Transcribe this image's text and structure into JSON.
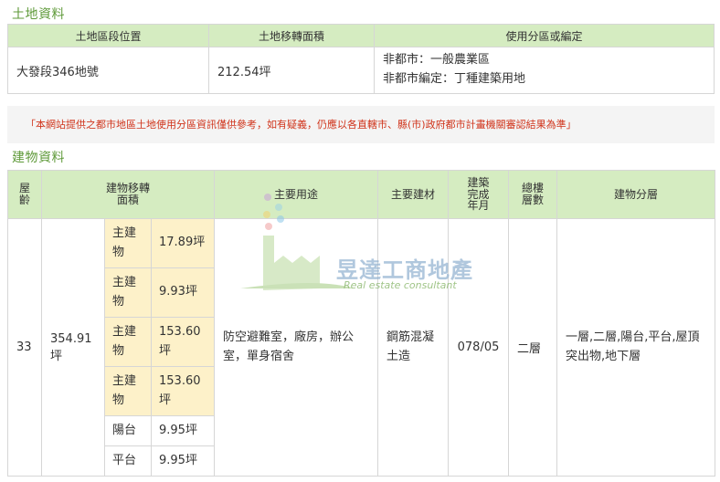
{
  "land_section": {
    "title": "土地資料",
    "headers": [
      "土地區段位置",
      "土地移轉面積",
      "使用分區或編定"
    ],
    "row": {
      "location": "大發段346地號",
      "area": "212.54坪",
      "zoning_line1": "非都市：一般農業區",
      "zoning_line2": "非都市編定：丁種建築用地"
    }
  },
  "notice": "「本網站提供之都市地區土地使用分區資訊僅供參考，如有疑義，仍應以各直轄市、縣(市)政府都市計畫機關審認結果為準」",
  "building_section": {
    "title": "建物資料",
    "headers": {
      "age": "屋齡",
      "area": "建物移轉面積",
      "use": "主要用途",
      "material": "主要建材",
      "completion": "建築完成年月",
      "floors": "總樓層數",
      "levels": "建物分層"
    },
    "row": {
      "age": "33",
      "total_area": "354.91坪",
      "sub_areas": [
        {
          "label": "主建物",
          "area": "17.89坪",
          "highlight": true
        },
        {
          "label": "主建物",
          "area": "9.93坪",
          "highlight": true
        },
        {
          "label": "主建物",
          "area": "153.60坪",
          "highlight": true
        },
        {
          "label": "主建物",
          "area": "153.60坪",
          "highlight": true
        },
        {
          "label": "陽台",
          "area": "9.95坪",
          "highlight": false
        },
        {
          "label": "平台",
          "area": "9.95坪",
          "highlight": false
        }
      ],
      "use": "防空避難室，廠房，辦公室，單身宿舍",
      "material": "鋼筋混凝土造",
      "completion": "078/05",
      "floors": "二層",
      "levels": "一層,二層,陽台,平台,屋頂突出物,地下層"
    }
  },
  "watermark": {
    "name": "昱達工商地產",
    "subtitle": "Real estate consultant"
  },
  "colors": {
    "header_bg": "#d5ecc1",
    "title_green": "#5f9a3a",
    "highlight_bg": "#fdf1c9",
    "notice_red": "#d0341b"
  }
}
